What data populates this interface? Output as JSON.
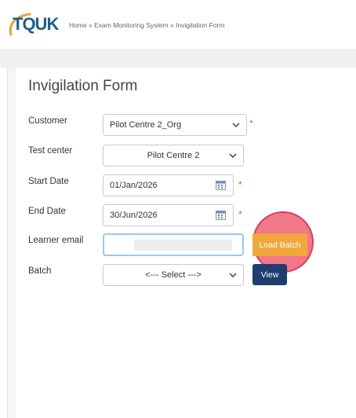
{
  "header": {
    "logo_text": "TQUK",
    "breadcrumb": "Home » Exam Monitoring System » Invigilation Form"
  },
  "form": {
    "title": "Invigilation Form",
    "customer": {
      "label": "Customer",
      "value": "Pilot Centre 2_Org"
    },
    "test_center": {
      "label": "Test center",
      "value": "Pilot Centre 2"
    },
    "start_date": {
      "label": "Start Date",
      "value": "01/Jan/2026"
    },
    "end_date": {
      "label": "End Date",
      "value": "30/Jun/2026"
    },
    "learner_email": {
      "label": "Learner email",
      "value": ""
    },
    "batch": {
      "label": "Batch",
      "value": "<--- Select --->"
    },
    "required_mark": "*",
    "load_batch_label": "Load Batch",
    "view_label": "View"
  },
  "colors": {
    "brand": "#1e5e8c",
    "required": "#d9534f",
    "load_button": "#f0a83c",
    "view_button": "#1f3e6e",
    "highlight": "#ee5a6e"
  }
}
